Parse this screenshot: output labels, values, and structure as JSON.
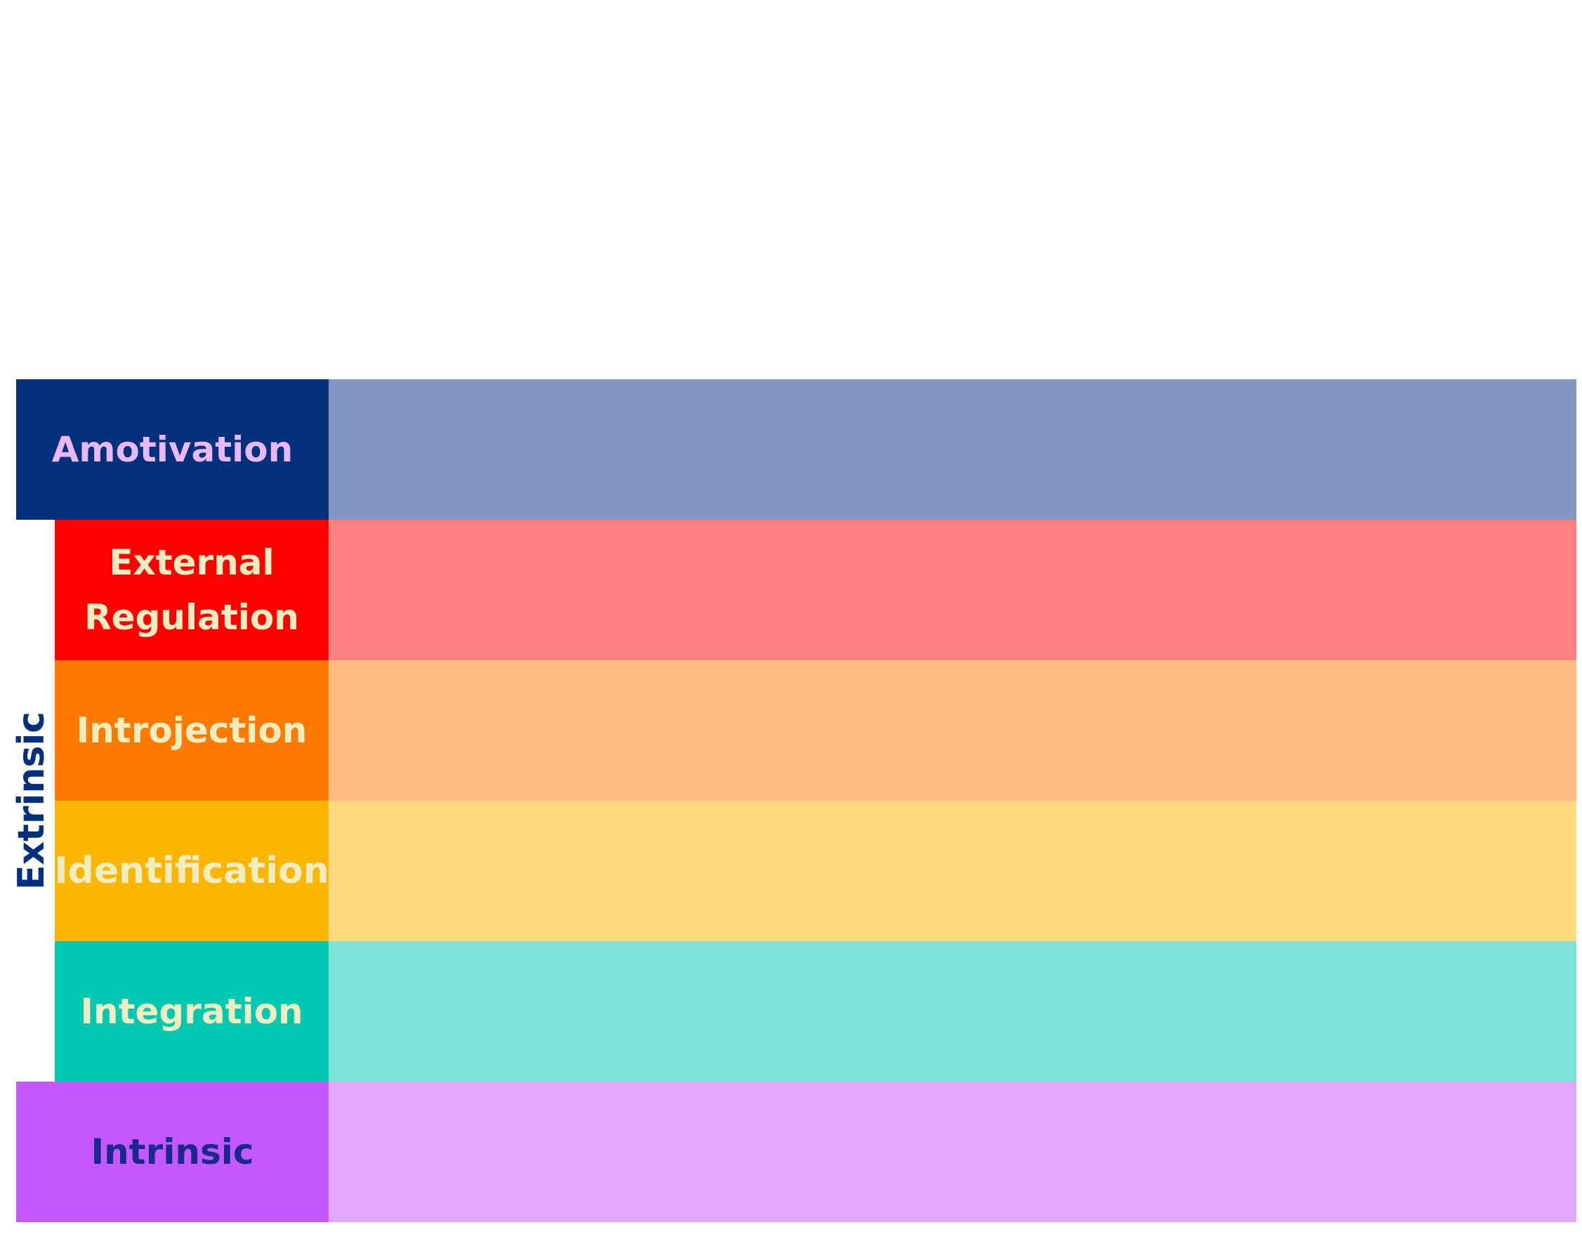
{
  "side_label": "Extrinsic",
  "rows": [
    {
      "label": "Amotivation",
      "label_bg": "#03307d",
      "label_color": "#e9b8f8",
      "fill_bg": "#8298c0"
    },
    {
      "label_lines": [
        "External",
        "Regulation"
      ],
      "label_bg": "#ff0000",
      "label_color": "#f0edc0",
      "fill_bg": "#ff8080"
    },
    {
      "label": "Introjection",
      "label_bg": "#ff7b00",
      "label_color": "#f0edc0",
      "fill_bg": "#febc80"
    },
    {
      "label": "Identification",
      "label_bg": "#fcb600",
      "label_color": "#f0edc0",
      "fill_bg": "#fdd980"
    },
    {
      "label": "Integration",
      "label_bg": "#00c8b0",
      "label_color": "#f0edc0",
      "fill_bg": "#80e3d7"
    },
    {
      "label": "Intrinsic",
      "label_bg": "#c558fd",
      "label_color": "#1a2a8c",
      "fill_bg": "#e2a7fe"
    }
  ]
}
